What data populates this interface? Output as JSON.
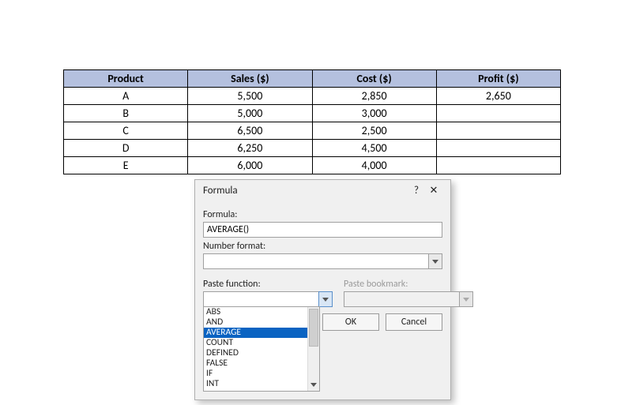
{
  "table": {
    "headers": [
      "Product",
      "Sales ($)",
      "Cost ($)",
      "Profit ($)"
    ],
    "rows": [
      {
        "product": "A",
        "sales": "5,500",
        "cost": "2,850",
        "profit": "2,650"
      },
      {
        "product": "B",
        "sales": "5,000",
        "cost": "3,000",
        "profit": ""
      },
      {
        "product": "C",
        "sales": "6,500",
        "cost": "2,500",
        "profit": ""
      },
      {
        "product": "D",
        "sales": "6,250",
        "cost": "4,500",
        "profit": ""
      },
      {
        "product": "E",
        "sales": "6,000",
        "cost": "4,000",
        "profit": ""
      }
    ]
  },
  "dialog": {
    "title": "Formula",
    "help_glyph": "?",
    "close_glyph": "✕",
    "formula_label": "Formula:",
    "formula_value": "AVERAGE()",
    "number_format_label": "Number format:",
    "number_format_value": "",
    "paste_function_label": "Paste function:",
    "paste_function_value": "",
    "paste_bookmark_label": "Paste bookmark:",
    "paste_bookmark_value": "",
    "functions": [
      "ABS",
      "AND",
      "AVERAGE",
      "COUNT",
      "DEFINED",
      "FALSE",
      "IF",
      "INT"
    ],
    "selected_function_index": 2,
    "ok_label": "OK",
    "cancel_label": "Cancel"
  }
}
